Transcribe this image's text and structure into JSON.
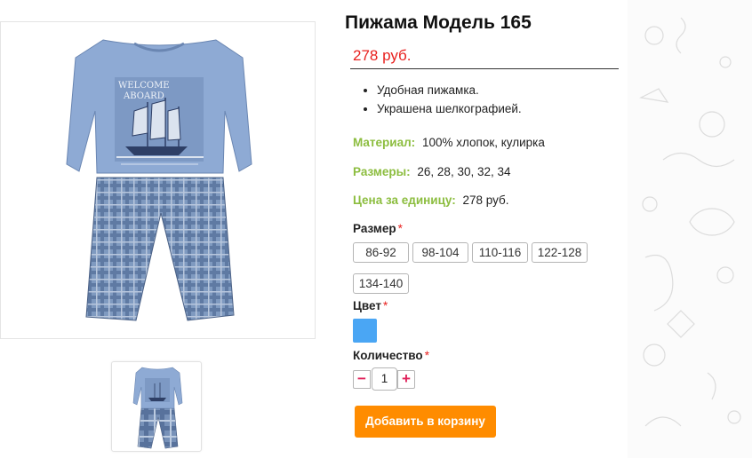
{
  "product": {
    "title": "Пижама Модель 165",
    "price": "278 руб.",
    "features": [
      "Удобная пижамка.",
      "Украшена шелкографией."
    ],
    "image_print_text": [
      "WELCOME",
      "ABOARD"
    ]
  },
  "specs": {
    "material_label": "Материал:",
    "material_value": "100% хлопок, кулирка",
    "sizes_label": "Размеры:",
    "sizes_value": "26, 28, 30, 32, 34",
    "unit_price_label": "Цена за единицу:",
    "unit_price_value": "278 руб."
  },
  "options": {
    "size_label": "Размер",
    "required_mark": "*",
    "sizes": [
      "86-92",
      "98-104",
      "110-116",
      "122-128",
      "134-140"
    ],
    "color_label": "Цвет",
    "color_value": "#4aa6f4",
    "quantity_label": "Количество",
    "quantity_value": "1",
    "minus": "−",
    "plus": "+"
  },
  "actions": {
    "add_to_cart": "Добавить в корзину"
  },
  "colors": {
    "price": "#e8201e",
    "spec_label": "#8cbd3f",
    "cart_button": "#ff8c00",
    "qty_symbols": "#e0215a"
  }
}
